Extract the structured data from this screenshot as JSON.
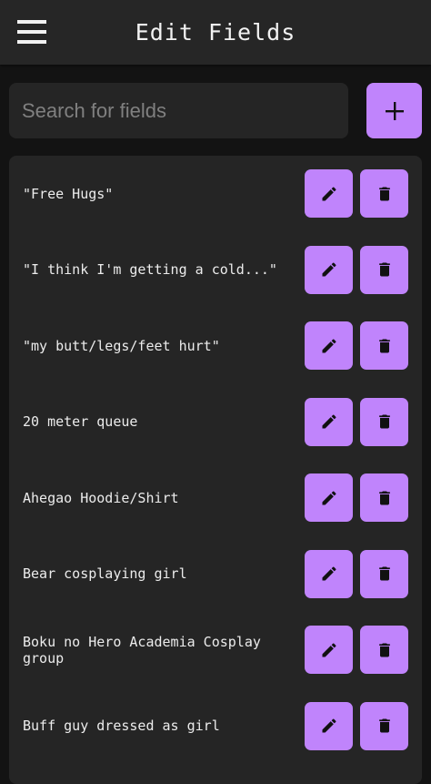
{
  "app_bar": {
    "title": "Edit Fields",
    "menu_icon": "hamburger-menu-icon"
  },
  "search": {
    "placeholder": "Search for fields",
    "value": ""
  },
  "add_button": {
    "icon": "plus-icon"
  },
  "fields": [
    {
      "label": "\"Free Hugs\""
    },
    {
      "label": "\"I think I'm getting a cold...\""
    },
    {
      "label": "\"my butt/legs/feet hurt\""
    },
    {
      "label": "20 meter queue"
    },
    {
      "label": "Ahegao Hoodie/Shirt"
    },
    {
      "label": "Bear cosplaying girl"
    },
    {
      "label": "Boku no Hero Academia Cosplay group"
    },
    {
      "label": "Buff guy dressed as girl"
    }
  ],
  "row_actions": {
    "edit_icon": "pencil-icon",
    "delete_icon": "trash-icon"
  },
  "colors": {
    "accent": "#c084fc",
    "background": "#131313",
    "surface": "#252525",
    "app_bar": "#262626",
    "text": "#ececec"
  }
}
